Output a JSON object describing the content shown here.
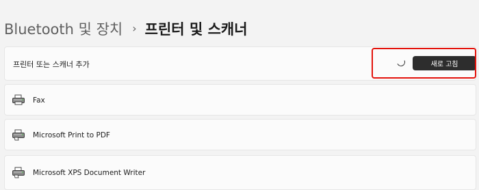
{
  "breadcrumb": {
    "parent": "Bluetooth 및 장치",
    "separator": "›",
    "current": "프린터 및 스캐너"
  },
  "add_printer": {
    "label": "프린터 또는 스캐너 추가",
    "refresh_button": "새로 고침",
    "spinner_icon": "loading-spinner-icon"
  },
  "devices": [
    {
      "name": "Fax",
      "icon": "fax-printer-icon"
    },
    {
      "name": "Microsoft Print to PDF",
      "icon": "pdf-printer-icon"
    },
    {
      "name": "Microsoft XPS Document Writer",
      "icon": "xps-printer-icon"
    }
  ],
  "colors": {
    "background": "#f3f3f3",
    "card": "#fbfbfb",
    "button": "#2d2d2d",
    "highlight": "#e3120b"
  }
}
